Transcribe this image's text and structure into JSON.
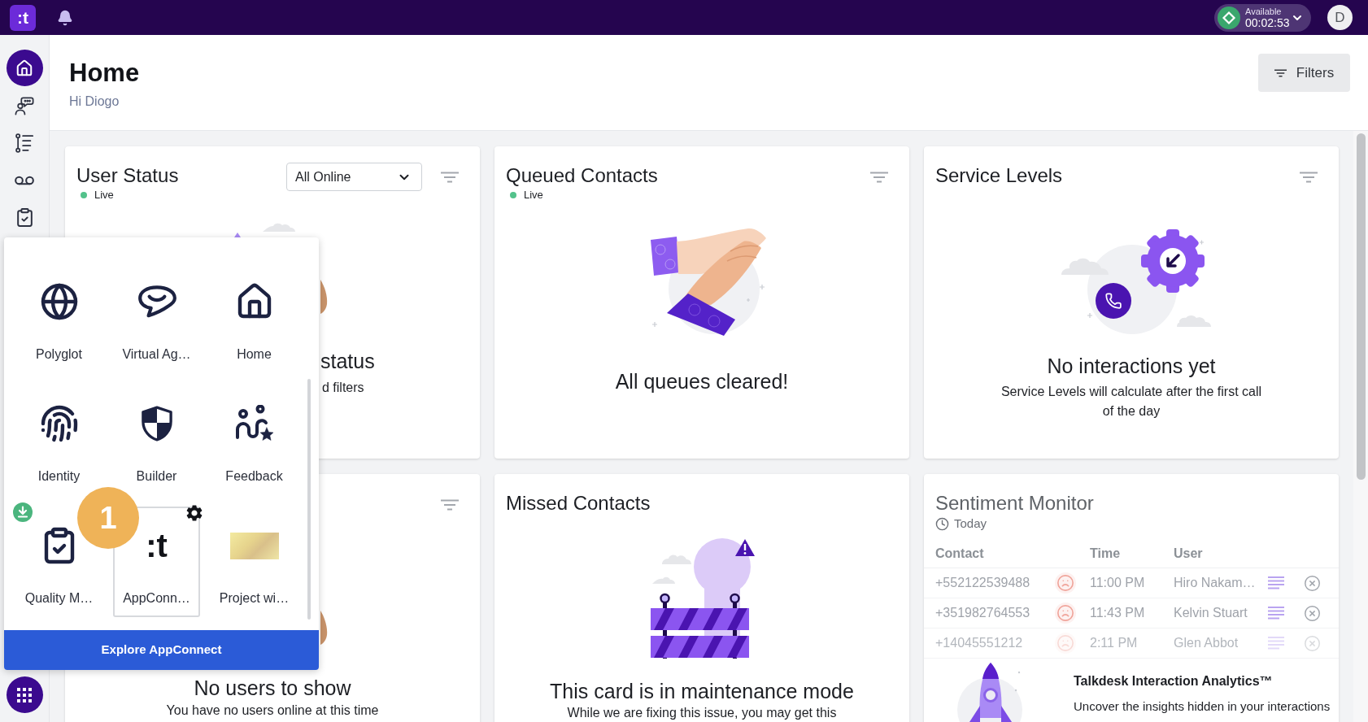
{
  "top_bar": {
    "logo": ":t",
    "status": {
      "label": "Available",
      "timer": "00:02:53"
    },
    "avatar": "D"
  },
  "sidebar": {
    "items": [
      {
        "selected": true
      },
      {
        "selected": false
      },
      {
        "selected": false
      },
      {
        "selected": false
      },
      {
        "selected": false
      }
    ],
    "apps_launcher": {
      "open": true
    }
  },
  "header": {
    "title": "Home",
    "subtitle": "Hi Diogo",
    "filters_button": "Filters"
  },
  "cards": [
    {
      "kind": "user_status",
      "title": "User Status",
      "live_label": "Live",
      "dropdown": "All Online",
      "filterable": true,
      "empty_title": "status",
      "empty_text": "d filters"
    },
    {
      "kind": "queued",
      "title": "Queued Contacts",
      "live_label": "Live",
      "filterable": true,
      "empty_title": "All queues cleared!"
    },
    {
      "kind": "service_levels",
      "title": "Service Levels",
      "filterable": true,
      "empty_title": "No interactions yet",
      "empty_text": "Service Levels will calculate after the first call of the day"
    },
    {
      "kind": "users",
      "filterable": true,
      "empty_title": "No users to show",
      "empty_text": "You have no users online at this time"
    },
    {
      "kind": "missed",
      "title": "Missed Contacts",
      "filterable": false,
      "empty_title": "This card is in maintenance mode",
      "empty_text": "While we are fixing this issue, you may get this"
    },
    {
      "kind": "sentiment",
      "title": "Sentiment Monitor",
      "period": "Today",
      "filterable": false,
      "table": {
        "columns": [
          "Contact",
          "Time",
          "User"
        ],
        "rows": [
          {
            "contact": "+552122539488",
            "time": "11:00 PM",
            "user": "Hiro Nakam…",
            "faded": false
          },
          {
            "contact": "+351982764553",
            "time": "11:43 PM",
            "user": "Kelvin Stuart",
            "faded": false
          },
          {
            "contact": "+14045551212",
            "time": "2:11 PM",
            "user": "Glen Abbot",
            "faded": true
          }
        ]
      },
      "promo": {
        "title": "Talkdesk Interaction Analytics™",
        "text": "Uncover the insights hidden in your interactions"
      }
    }
  ],
  "app_launcher": {
    "apps": [
      {
        "label": "Polyglot",
        "kind": "icon",
        "selected": false,
        "download": false
      },
      {
        "label": "Virtual Ag…",
        "kind": "icon",
        "selected": false,
        "download": false
      },
      {
        "label": "Home",
        "kind": "icon",
        "selected": false,
        "download": false
      },
      {
        "label": "Identity",
        "kind": "icon",
        "selected": false,
        "download": false
      },
      {
        "label": "Builder",
        "kind": "icon",
        "selected": false,
        "download": false
      },
      {
        "label": "Feedback",
        "kind": "icon",
        "selected": false,
        "download": false
      },
      {
        "label": "Quality M…",
        "kind": "icon",
        "selected": false,
        "download": true
      },
      {
        "label": "AppConn…",
        "kind": "logo",
        "selected": true,
        "download": false
      },
      {
        "label": "Project wi…",
        "kind": "thumbnail",
        "selected": false,
        "download": false
      }
    ],
    "logo_mark": ":t",
    "button": "Explore AppConnect",
    "step_marker": "1"
  }
}
